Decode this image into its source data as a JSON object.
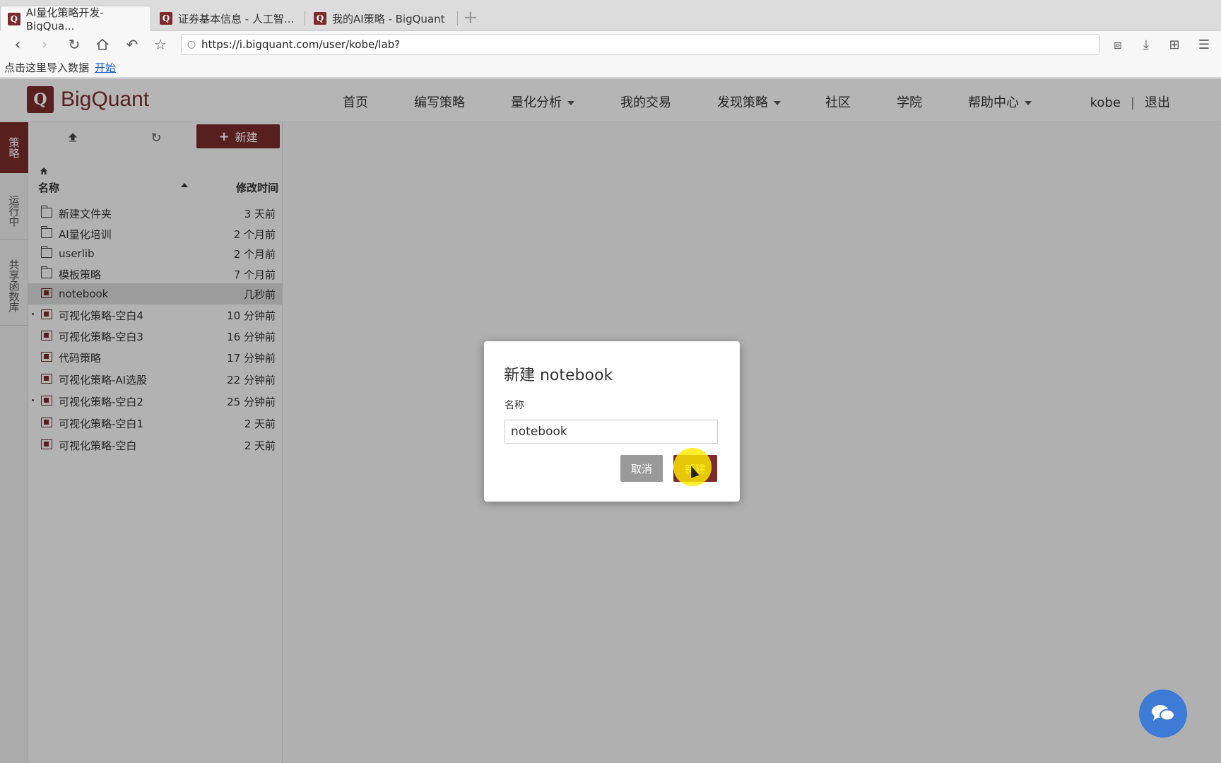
{
  "browser": {
    "tabs": [
      {
        "label": "AI量化策略开发-BigQua..."
      },
      {
        "label": "证券基本信息 - 人工智..."
      },
      {
        "label": "我的AI策略 - BigQuant"
      }
    ],
    "url": "https://i.bigquant.com/user/kobe/lab?",
    "bookmark": {
      "text": "点击这里导入数据",
      "link": "开始"
    },
    "favicon_letter": "Q"
  },
  "app": {
    "logo_letter": "Q",
    "brand": "BigQuant",
    "nav": [
      {
        "label": "首页"
      },
      {
        "label": "编写策略"
      },
      {
        "label": "量化分析"
      },
      {
        "label": "我的交易"
      },
      {
        "label": "发现策略"
      },
      {
        "label": "社区"
      },
      {
        "label": "学院"
      },
      {
        "label": "帮助中心"
      }
    ],
    "user": "kobe",
    "separator": "|",
    "logout": "退出",
    "accent_color": "#7b2b2b"
  },
  "rail": {
    "tabs": [
      {
        "label": "策略"
      },
      {
        "label": "运行中"
      },
      {
        "label": "共享函数库"
      }
    ]
  },
  "panel": {
    "new_button": "新建",
    "col_name": "名称",
    "col_time": "修改时间",
    "files": [
      {
        "name": "新建文件夹",
        "time": "3 天前",
        "type": "folder"
      },
      {
        "name": "AI量化培训",
        "time": "2 个月前",
        "type": "folder"
      },
      {
        "name": "userlib",
        "time": "2 个月前",
        "type": "folder"
      },
      {
        "name": "模板策略",
        "time": "7 个月前",
        "type": "folder"
      },
      {
        "name": "notebook",
        "time": "几秒前",
        "type": "notebook"
      },
      {
        "name": "可视化策略-空白4",
        "time": "10 分钟前",
        "type": "notebook"
      },
      {
        "name": "可视化策略-空白3",
        "time": "16 分钟前",
        "type": "notebook"
      },
      {
        "name": "代码策略",
        "time": "17 分钟前",
        "type": "notebook"
      },
      {
        "name": "可视化策略-AI选股",
        "time": "22 分钟前",
        "type": "notebook"
      },
      {
        "name": "可视化策略-空白2",
        "time": "25 分钟前",
        "type": "notebook"
      },
      {
        "name": "可视化策略-空白1",
        "time": "2 天前",
        "type": "notebook"
      },
      {
        "name": "可视化策略-空白",
        "time": "2 天前",
        "type": "notebook"
      }
    ]
  },
  "modal": {
    "title": "新建 notebook",
    "label": "名称",
    "value": "notebook",
    "cancel": "取消",
    "create": "新建"
  }
}
